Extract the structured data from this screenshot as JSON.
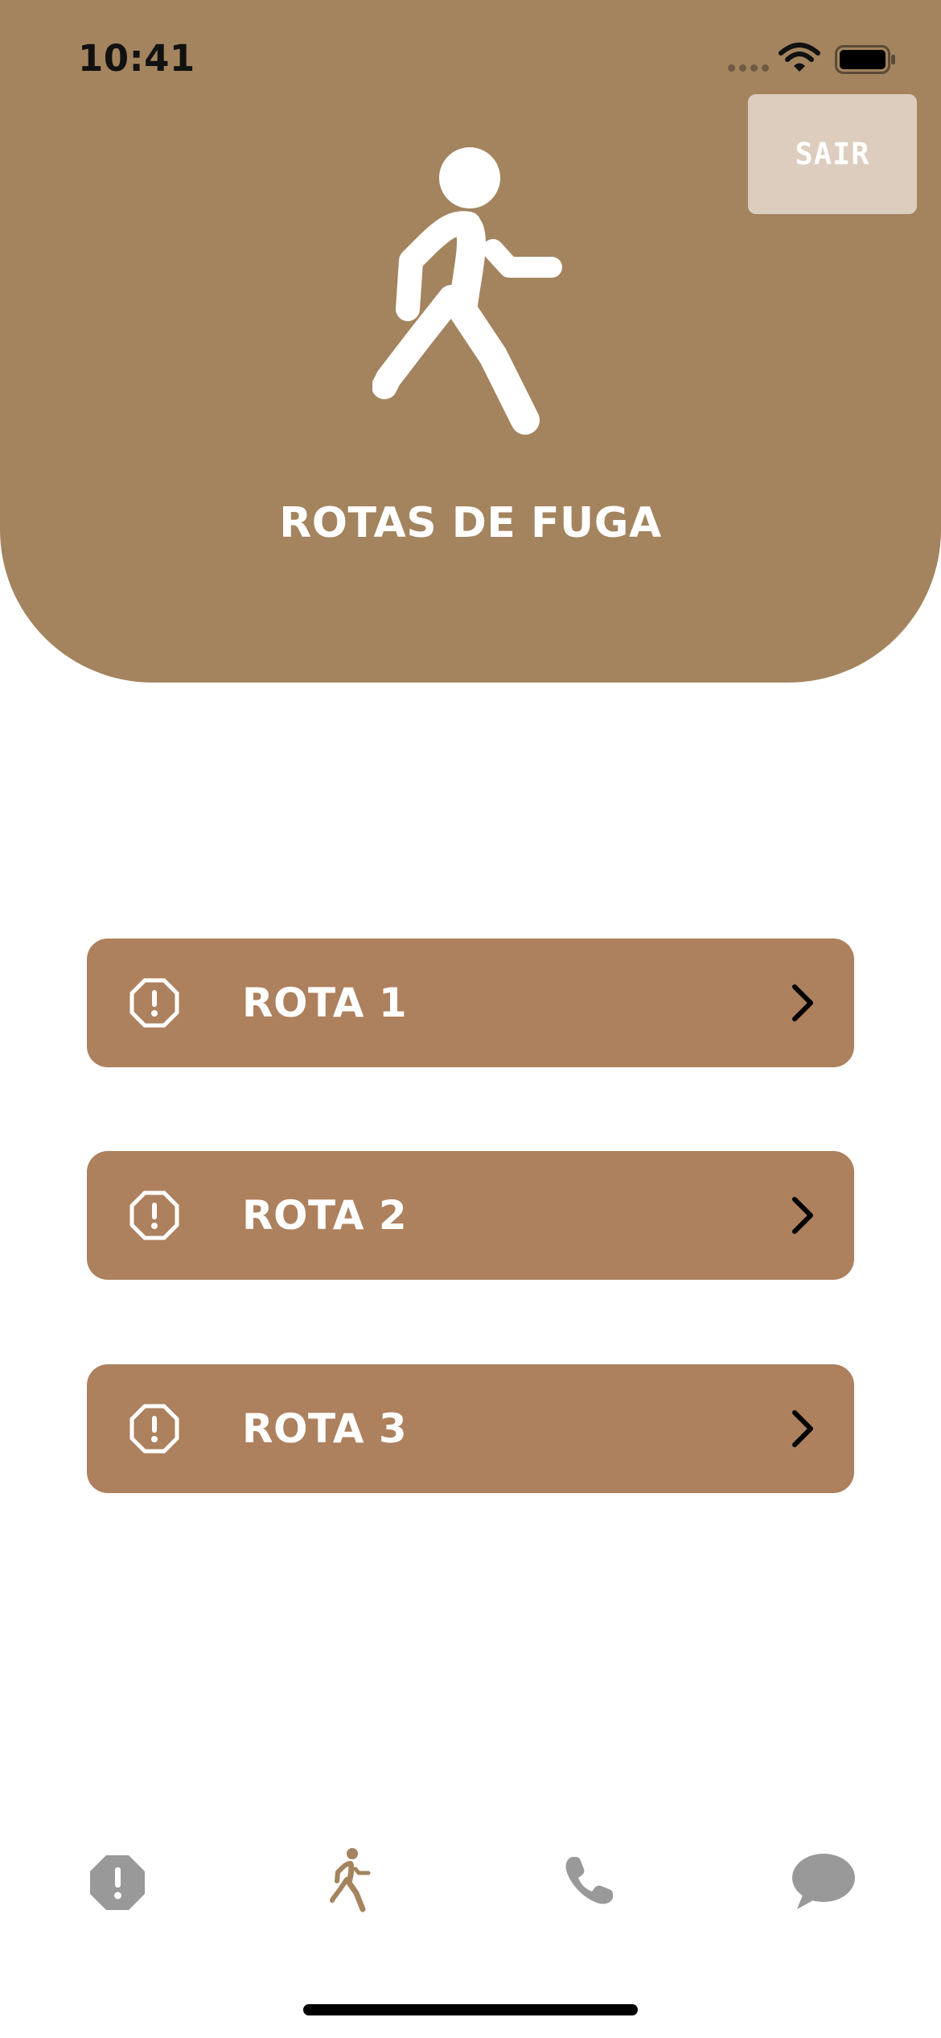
{
  "status_bar": {
    "time": "10:41",
    "icons": [
      "signal-icon",
      "wifi-icon",
      "battery-icon"
    ]
  },
  "header": {
    "title": "ROTAS DE FUGA",
    "exit_button": "SAIR",
    "icon": "walking-person-icon"
  },
  "routes": [
    {
      "label": "ROTA 1",
      "icon": "alert-octagon-icon",
      "trailing": "chevron-right-icon"
    },
    {
      "label": "ROTA 2",
      "icon": "alert-octagon-icon",
      "trailing": "chevron-right-icon"
    },
    {
      "label": "ROTA 3",
      "icon": "alert-octagon-icon",
      "trailing": "chevron-right-icon"
    }
  ],
  "tab_bar": {
    "items": [
      {
        "name": "alert",
        "icon": "alert-octagon-icon",
        "active": false
      },
      {
        "name": "routes",
        "icon": "walking-person-icon",
        "active": true
      },
      {
        "name": "phone",
        "icon": "phone-icon",
        "active": false
      },
      {
        "name": "chat",
        "icon": "chat-bubble-icon",
        "active": false
      }
    ]
  },
  "colors": {
    "header_bg": "#A3845E",
    "route_bg": "#AD805E",
    "exit_button_bg": "#DDCDBE",
    "tab_active": "#A3845E",
    "tab_inactive": "#999999"
  }
}
